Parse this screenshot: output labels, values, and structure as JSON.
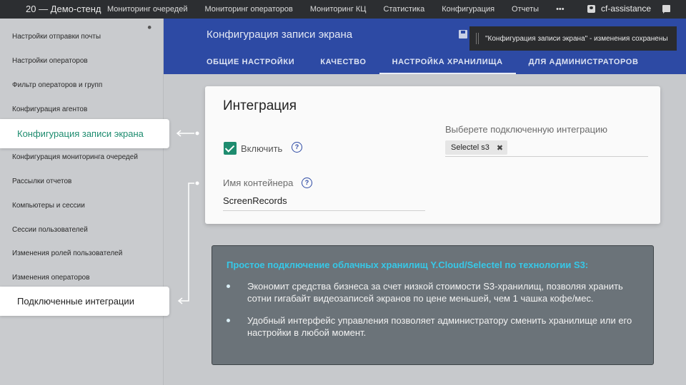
{
  "topbar": {
    "brand": "20 — Демо-стенд",
    "nav": [
      "Мониторинг очередей",
      "Мониторинг операторов",
      "Мониторинг КЦ",
      "Статистика",
      "Конфигурация",
      "Отчеты",
      "•••"
    ],
    "user": "cf-assistance"
  },
  "sidebar": {
    "items": [
      "Настройки отправки почты",
      "Настройки операторов",
      "Фильтр операторов и групп",
      "Конфигурация агентов",
      "Конфигурация записи экрана",
      "Конфигурация мониторинга очередей",
      "Рассылки отчетов",
      "Компьютеры и сессии",
      "Сессии пользователей",
      "Изменения ролей пользователей",
      "Изменения операторов",
      "Подключенные интеграции"
    ]
  },
  "header": {
    "title": "Конфигурация записи экрана",
    "tabs": [
      "ОБЩИЕ НАСТРОЙКИ",
      "КАЧЕСТВО",
      "НАСТРОЙКА ХРАНИЛИЩА",
      "ДЛЯ АДМИНИСТРАТОРОВ"
    ]
  },
  "toast": {
    "message": "\"Конфигурация записи экрана\" - изменения сохранены"
  },
  "card": {
    "title": "Интеграция",
    "enable_label": "Включить",
    "container_label": "Имя контейнера",
    "container_value": "ScreenRecords",
    "integration_label": "Выберете подключенную интеграцию",
    "integration_chip": "Selectel s3"
  },
  "info": {
    "heading": "Простое подключение облачных хранилищ Y.Cloud/Selectel по технологии S3:",
    "bullets": [
      "Экономит средства бизнеса за счет низкой стоимости S3-хранилищ, позволяя хранить сотни гигабайт видеозаписей экранов по цене меньшей, чем 1 чашка кофе/мес.",
      "Удобный интерфейс управления позволяет администратору сменить хранилище или его настройки в любой момент."
    ]
  },
  "colors": {
    "header_blue": "#2d4aa4",
    "accent_green": "#1e8c6f",
    "info_heading": "#36c8e8"
  }
}
